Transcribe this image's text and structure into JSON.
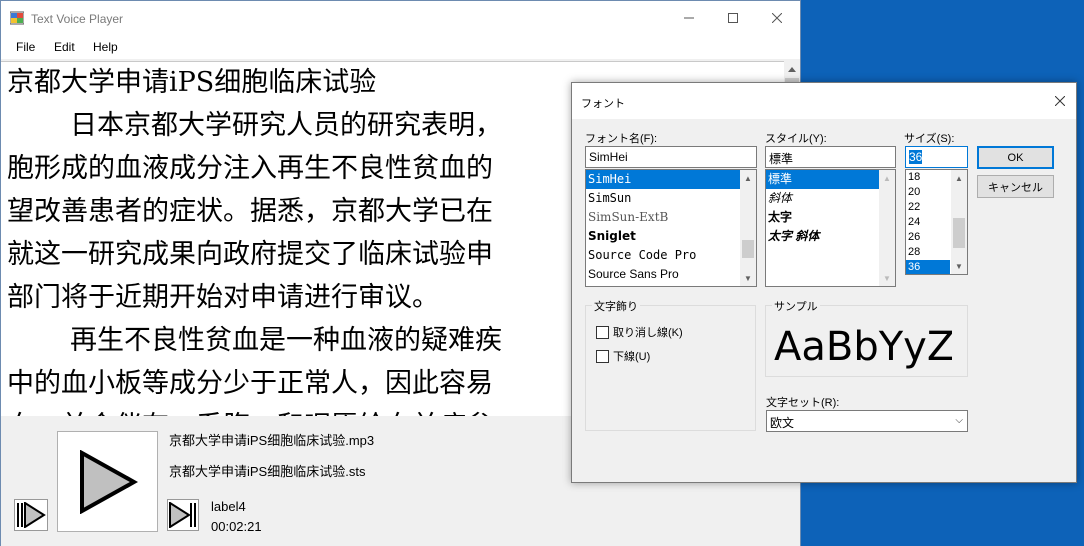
{
  "window": {
    "title": "Text Voice Player"
  },
  "menu": [
    "File",
    "Edit",
    "Help"
  ],
  "document": {
    "lines": [
      "京都大学申请iPS细胞临床试验",
      "日本京都大学研究人员的研究表明，",
      "胞形成的血液成分注入再生不良性贫血的",
      "望改善患者的症状。据悉，京都大学已在",
      "就这一研究成果向政府提交了临床试验申",
      "部门将于近期开始对申请进行审议。",
      "再生不良性贫血是一种血液的疑难疾",
      "中的血小板等成分少于正常人，因此容易",
      "血，并会伴有一系腹、和呢愿给血并症参"
    ]
  },
  "player": {
    "audio_file": "京都大学申请iPS细胞临床试验.mp3",
    "sts_file": "京都大学申请iPS细胞临床试验.sts",
    "label": "label4",
    "time": "00:02:21"
  },
  "font_dialog": {
    "title": "フォント",
    "font_name_label": "フォント名(F):",
    "font_name_value": "SimHei",
    "font_list": [
      "SimHei",
      "SimSun",
      "SimSun-ExtB",
      "Sniglet",
      "Source Code Pro",
      "Source Sans Pro"
    ],
    "style_label": "スタイル(Y):",
    "style_value": "標準",
    "style_list": [
      "標準",
      "斜体",
      "太字",
      "太字 斜体"
    ],
    "size_label": "サイズ(S):",
    "size_value": "36",
    "size_list": [
      "18",
      "20",
      "22",
      "24",
      "26",
      "28",
      "36"
    ],
    "ok_label": "OK",
    "cancel_label": "キャンセル",
    "effects_label": "文字飾り",
    "strikeout_label": "取り消し線(K)",
    "underline_label": "下線(U)",
    "sample_label": "サンプル",
    "sample_text": "AaBbYyZz",
    "charset_label": "文字セット(R):",
    "charset_value": "欧文"
  }
}
